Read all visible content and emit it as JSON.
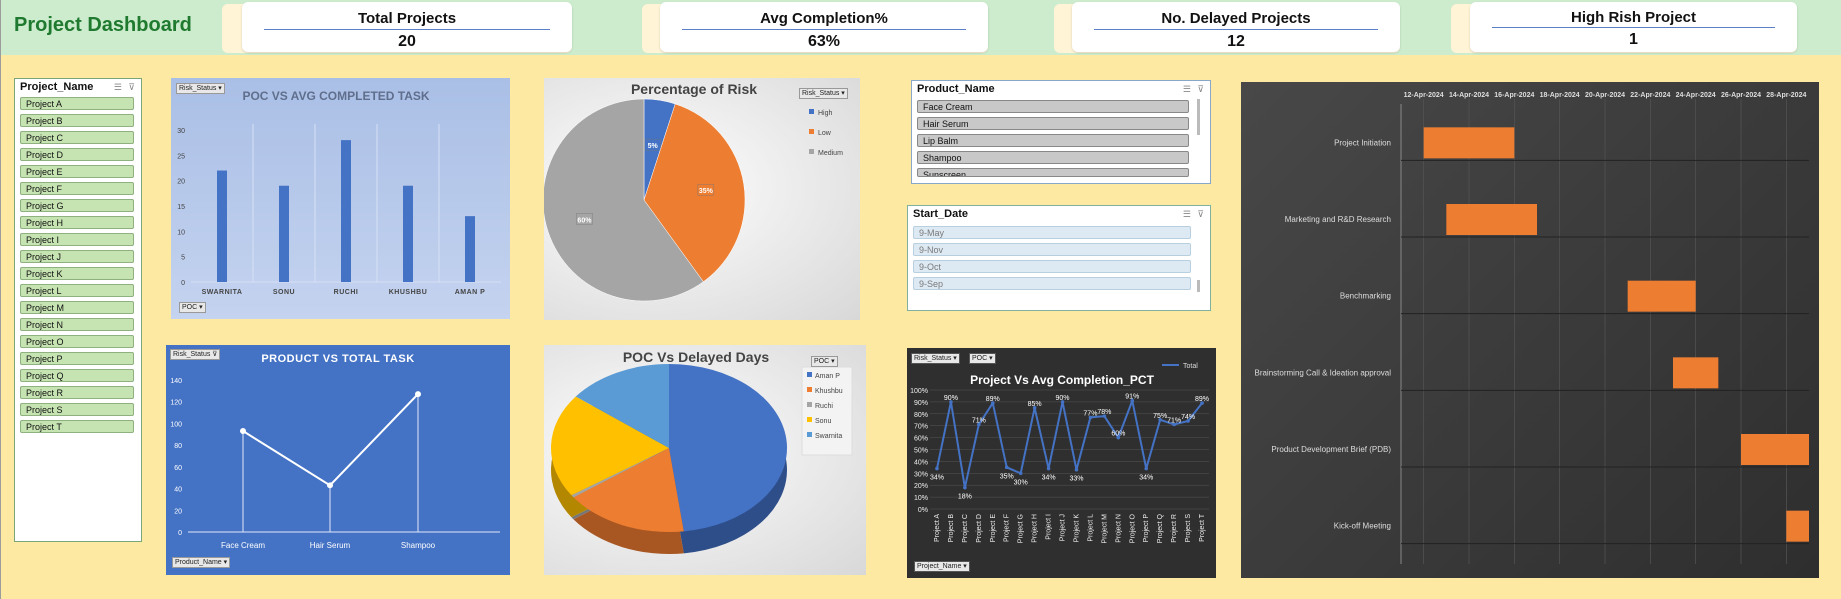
{
  "dashboard": {
    "title": "Project Dashboard"
  },
  "kpis": [
    {
      "label": "Total Projects",
      "value": "20"
    },
    {
      "label": "Avg Completion%",
      "value": "63%"
    },
    {
      "label": "No. Delayed Projects",
      "value": "12"
    },
    {
      "label": "High Rish Project",
      "value": "1"
    }
  ],
  "project_slicer": {
    "header": "Project_Name",
    "items": [
      "Project A",
      "Project B",
      "Project C",
      "Project D",
      "Project E",
      "Project F",
      "Project G",
      "Project H",
      "Project I",
      "Project J",
      "Project K",
      "Project L",
      "Project M",
      "Project N",
      "Project O",
      "Project P",
      "Project Q",
      "Project R",
      "Project S",
      "Project T"
    ]
  },
  "product_slicer": {
    "header": "Product_Name",
    "items": [
      "Face Cream",
      "Hair Serum",
      "Lip Balm",
      "Shampoo",
      "Sunscreen"
    ]
  },
  "date_slicer": {
    "header": "Start_Date",
    "items": [
      "9-May",
      "9-Nov",
      "9-Oct",
      "9-Sep"
    ]
  },
  "filters": {
    "risk_status": "Risk_Status",
    "poc": "POC",
    "product_name": "Product_Name",
    "project_name": "Project_Name"
  },
  "chart_data": [
    {
      "type": "bar",
      "title": "POC VS AVG COMPLETED TASK",
      "categories": [
        "SWARNITA",
        "SONU",
        "RUCHI",
        "KHUSHBU",
        "AMAN P"
      ],
      "values": [
        22,
        19,
        28,
        19,
        13
      ],
      "ylim": [
        0,
        30
      ],
      "yticks": [
        "0",
        "5",
        "10",
        "15",
        "20",
        "25",
        "30"
      ],
      "colors": {
        "bar": "#4472c4",
        "background": "#aabfe6"
      }
    },
    {
      "type": "pie",
      "title": "Percentage of Risk",
      "labels": [
        "High",
        "Low",
        "Medium"
      ],
      "values": [
        5,
        35,
        60
      ],
      "data_labels": [
        "5%",
        "35%",
        "60%"
      ],
      "colors": [
        "#4472c4",
        "#ed7d31",
        "#a5a5a5"
      ],
      "legend": "right"
    },
    {
      "type": "line",
      "title": "PRODUCT VS TOTAL TASK",
      "categories": [
        "Face Cream",
        "Hair Serum",
        "Shampoo"
      ],
      "values": [
        93,
        43,
        127
      ],
      "ylim": [
        0,
        140
      ],
      "yticks": [
        "0",
        "20",
        "40",
        "60",
        "80",
        "100",
        "120",
        "140"
      ],
      "colors": {
        "line": "#ffffff",
        "background": "#4472c4"
      }
    },
    {
      "type": "pie",
      "title": "POC Vs Delayed Days",
      "labels": [
        "Aman P",
        "Khushbu",
        "Ruchi",
        "Sonu",
        "Swarnita"
      ],
      "values": [
        48,
        17,
        0.5,
        20,
        14.5
      ],
      "colors": [
        "#4472c4",
        "#ed7d31",
        "#a5a5a5",
        "#ffc000",
        "#5b9bd5"
      ],
      "legend": "right"
    },
    {
      "type": "line",
      "title": "Project Vs Avg Completion_PCT",
      "categories": [
        "Project A",
        "Project B",
        "Project C",
        "Project D",
        "Project E",
        "Project F",
        "Project G",
        "Project H",
        "Project I",
        "Project J",
        "Project K",
        "Project L",
        "Project M",
        "Project N",
        "Project O",
        "Project P",
        "Project Q",
        "Project R",
        "Project S",
        "Project T"
      ],
      "values": [
        34,
        90,
        18,
        71,
        89,
        35,
        30,
        85,
        34,
        90,
        33,
        77,
        78,
        60,
        91,
        34,
        75,
        71,
        74,
        89
      ],
      "data_labels": [
        "34%",
        "90%",
        "18%",
        "71%",
        "89%",
        "35%",
        "30%",
        "85%",
        "34%",
        "90%",
        "33%",
        "77%",
        "78%",
        "60%",
        "91%",
        "34%",
        "75%",
        "71%",
        "74%",
        "89%"
      ],
      "ylim": [
        0,
        100
      ],
      "yticks": [
        "0%",
        "10%",
        "20%",
        "30%",
        "40%",
        "50%",
        "60%",
        "70%",
        "80%",
        "90%",
        "100%"
      ],
      "series": [
        {
          "name": "Total"
        }
      ],
      "colors": {
        "line": "#4472c4",
        "background": "#2f2f2f"
      }
    },
    {
      "type": "bar",
      "orientation": "gantt",
      "categories": [
        "Project Initiation",
        "Marketing and R&D Research",
        "Benchmarking",
        "Brainstorming Call & Ideation approval",
        "Product Development Brief (PDB)",
        "Kick-off Meeting"
      ],
      "start": [
        "2024-04-12",
        "2024-04-13",
        "2024-04-21",
        "2024-04-23",
        "2024-04-26",
        "2024-04-28"
      ],
      "end": [
        "2024-04-16",
        "2024-04-17",
        "2024-04-24",
        "2024-04-25",
        "2024-04-29",
        "2024-04-29"
      ],
      "x_ticks": [
        "12-Apr-2024",
        "14-Apr-2024",
        "16-Apr-2024",
        "18-Apr-2024",
        "20-Apr-2024",
        "22-Apr-2024",
        "24-Apr-2024",
        "26-Apr-2024",
        "28-Apr-2024"
      ],
      "colors": {
        "bar": "#ed7d31",
        "background": "#3d3d3d"
      }
    }
  ]
}
